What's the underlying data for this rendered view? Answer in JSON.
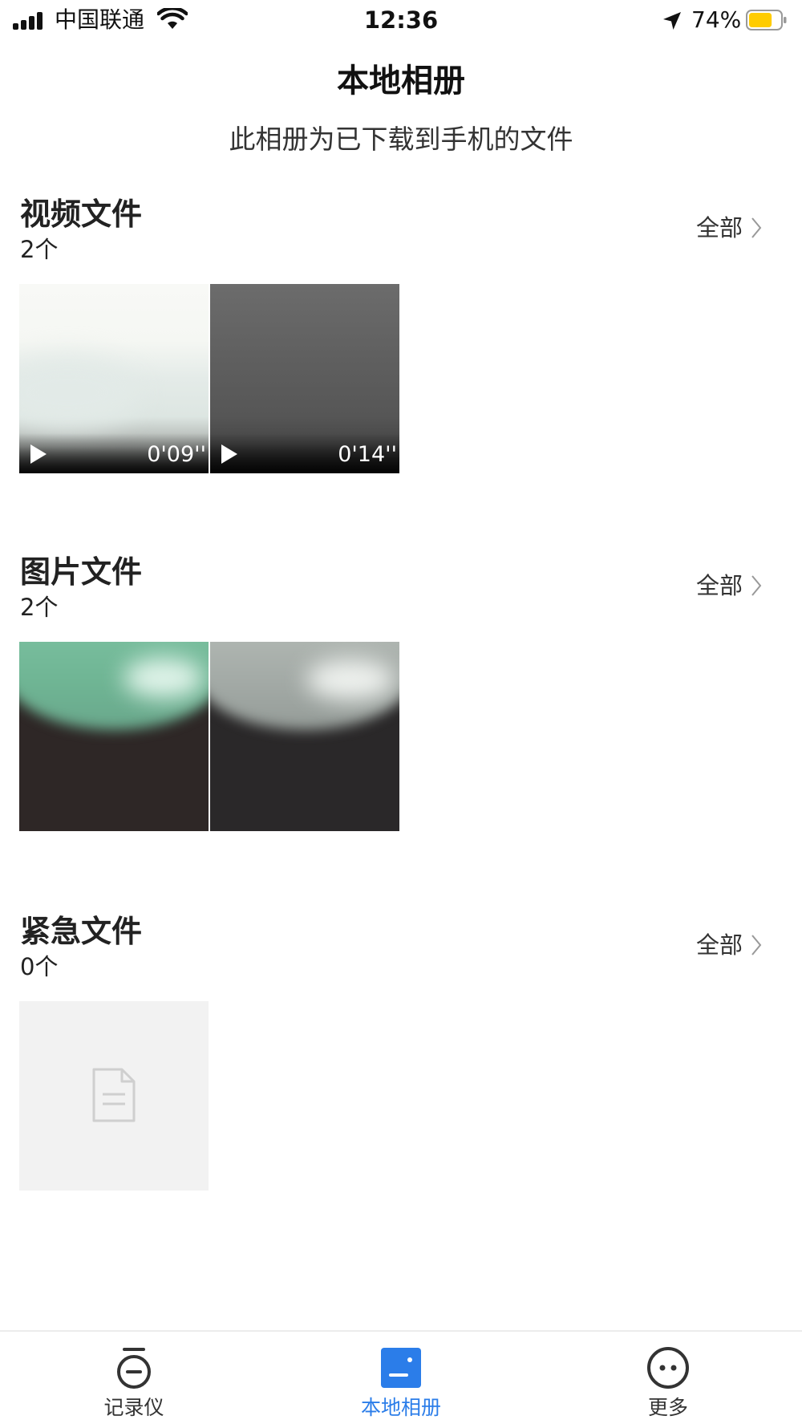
{
  "status_bar": {
    "carrier": "中国联通",
    "time": "12:36",
    "battery_percent": "74%",
    "battery_level": 0.74,
    "battery_color": "#ffcc00",
    "icons": [
      "signal-icon",
      "wifi-icon",
      "location-arrow-icon",
      "battery-icon"
    ]
  },
  "header": {
    "title": "本地相册",
    "subtitle": "此相册为已下载到手机的文件"
  },
  "sections": [
    {
      "title": "视频文件",
      "count": "2个",
      "view_all": "全部",
      "items": [
        {
          "type": "video",
          "duration": "0'09''"
        },
        {
          "type": "video",
          "duration": "0'14''"
        }
      ]
    },
    {
      "title": "图片文件",
      "count": "2个",
      "view_all": "全部",
      "items": [
        {
          "type": "photo"
        },
        {
          "type": "photo"
        }
      ]
    },
    {
      "title": "紧急文件",
      "count": "0个",
      "view_all": "全部",
      "items": [
        {
          "type": "placeholder",
          "icon": "document-icon"
        }
      ]
    }
  ],
  "tab_bar": {
    "active_color": "#2b7de9",
    "tabs": [
      {
        "label": "记录仪",
        "icon": "recorder-icon",
        "active": false
      },
      {
        "label": "本地相册",
        "icon": "album-icon",
        "active": true
      },
      {
        "label": "更多",
        "icon": "more-icon",
        "active": false
      }
    ]
  }
}
